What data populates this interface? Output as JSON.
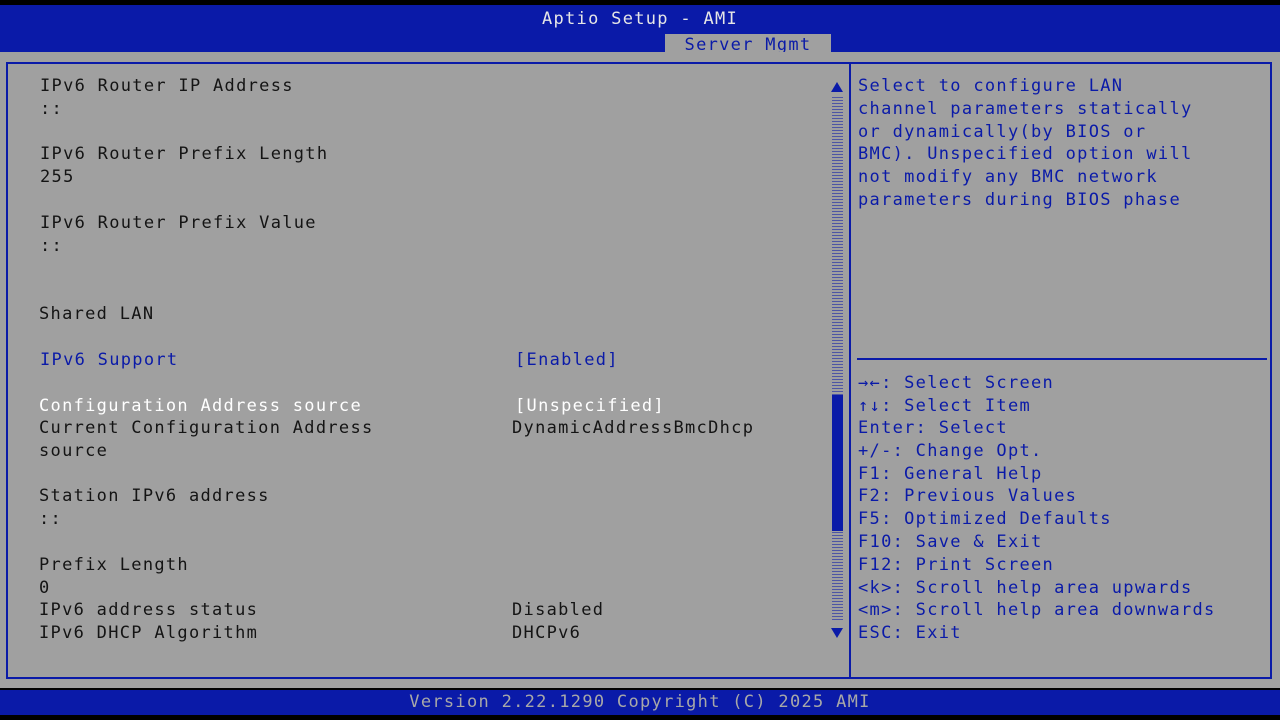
{
  "header": {
    "title": "Aptio Setup - AMI",
    "active_tab": "Server Mgmt"
  },
  "settings": {
    "router_ip_label": "IPv6 Router IP Address",
    "router_ip_value": "::",
    "router_prefix_len_label": "IPv6 Router Prefix Length",
    "router_prefix_len_value": "255",
    "router_prefix_val_label": "IPv6 Router Prefix Value",
    "router_prefix_val_value": "::",
    "shared_lan_heading": "Shared LAN",
    "ipv6_support_label": "IPv6 Support",
    "ipv6_support_value": "[Enabled]",
    "config_addr_source_label": "Configuration Address source",
    "config_addr_source_value": "[Unspecified]",
    "current_config_label_line1": "Current Configuration Address",
    "current_config_label_line2": "source",
    "current_config_value": "DynamicAddressBmcDhcp",
    "station_ipv6_label": "Station IPv6 address",
    "station_ipv6_value": "::",
    "prefix_length_label": "Prefix Length",
    "prefix_length_value": "0",
    "ipv6_addr_status_label": "IPv6 address status",
    "ipv6_addr_status_value": "Disabled",
    "ipv6_dhcp_algo_label": "IPv6 DHCP Algorithm",
    "ipv6_dhcp_algo_value": "DHCPv6"
  },
  "help_text": [
    "Select to configure LAN",
    "channel parameters statically",
    "or dynamically(by BIOS or",
    "BMC). Unspecified option will",
    "not modify any BMC network",
    "parameters during BIOS phase"
  ],
  "key_help": [
    "→←: Select Screen",
    "↑↓: Select Item",
    "Enter: Select",
    "+/-: Change Opt.",
    "F1: General Help",
    "F2: Previous Values",
    "F5: Optimized Defaults",
    "F10: Save & Exit",
    "F12: Print Screen",
    "<k>: Scroll help area upwards",
    "<m>: Scroll help area downwards",
    "ESC: Exit"
  ],
  "scrollbar": {
    "position_fraction": 0.57
  },
  "footer": {
    "version": "Version 2.22.1290 Copyright (C) 2025 AMI"
  },
  "colors": {
    "bios_blue": "#0a1aa8",
    "panel_gray": "#a0a0a0",
    "highlight_white": "#ffffff"
  }
}
